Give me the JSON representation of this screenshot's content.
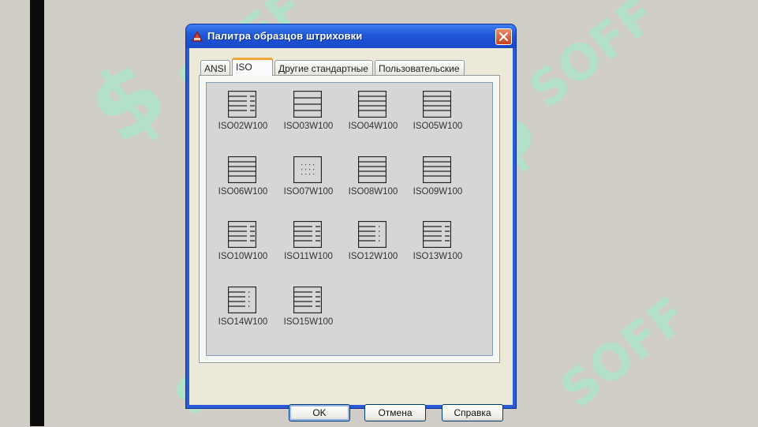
{
  "watermark": {
    "text": "SOFF"
  },
  "dialog": {
    "title": "Палитра образцов штриховки",
    "tabs": [
      {
        "label": "ANSI",
        "active": false
      },
      {
        "label": "ISO",
        "active": true
      },
      {
        "label": "Другие стандартные",
        "active": false
      },
      {
        "label": "Пользовательские",
        "active": false
      }
    ],
    "patterns": [
      {
        "label": "ISO02W100",
        "icon": "hatch-lines-dashed"
      },
      {
        "label": "ISO03W100",
        "icon": "hatch-lines-sparse"
      },
      {
        "label": "ISO04W100",
        "icon": "hatch-lines"
      },
      {
        "label": "ISO05W100",
        "icon": "hatch-lines"
      },
      {
        "label": "ISO06W100",
        "icon": "hatch-lines"
      },
      {
        "label": "ISO07W100",
        "icon": "hatch-dots"
      },
      {
        "label": "ISO08W100",
        "icon": "hatch-lines"
      },
      {
        "label": "ISO09W100",
        "icon": "hatch-lines"
      },
      {
        "label": "ISO10W100",
        "icon": "hatch-lines-dashed"
      },
      {
        "label": "ISO11W100",
        "icon": "hatch-lines-dashed"
      },
      {
        "label": "ISO12W100",
        "icon": "hatch-lines-dotted"
      },
      {
        "label": "ISO13W100",
        "icon": "hatch-lines-dashed"
      },
      {
        "label": "ISO14W100",
        "icon": "hatch-lines-dotted"
      },
      {
        "label": "ISO15W100",
        "icon": "hatch-lines-dashed"
      }
    ],
    "buttons": {
      "ok": "OK",
      "cancel": "Отмена",
      "help": "Справка"
    }
  }
}
